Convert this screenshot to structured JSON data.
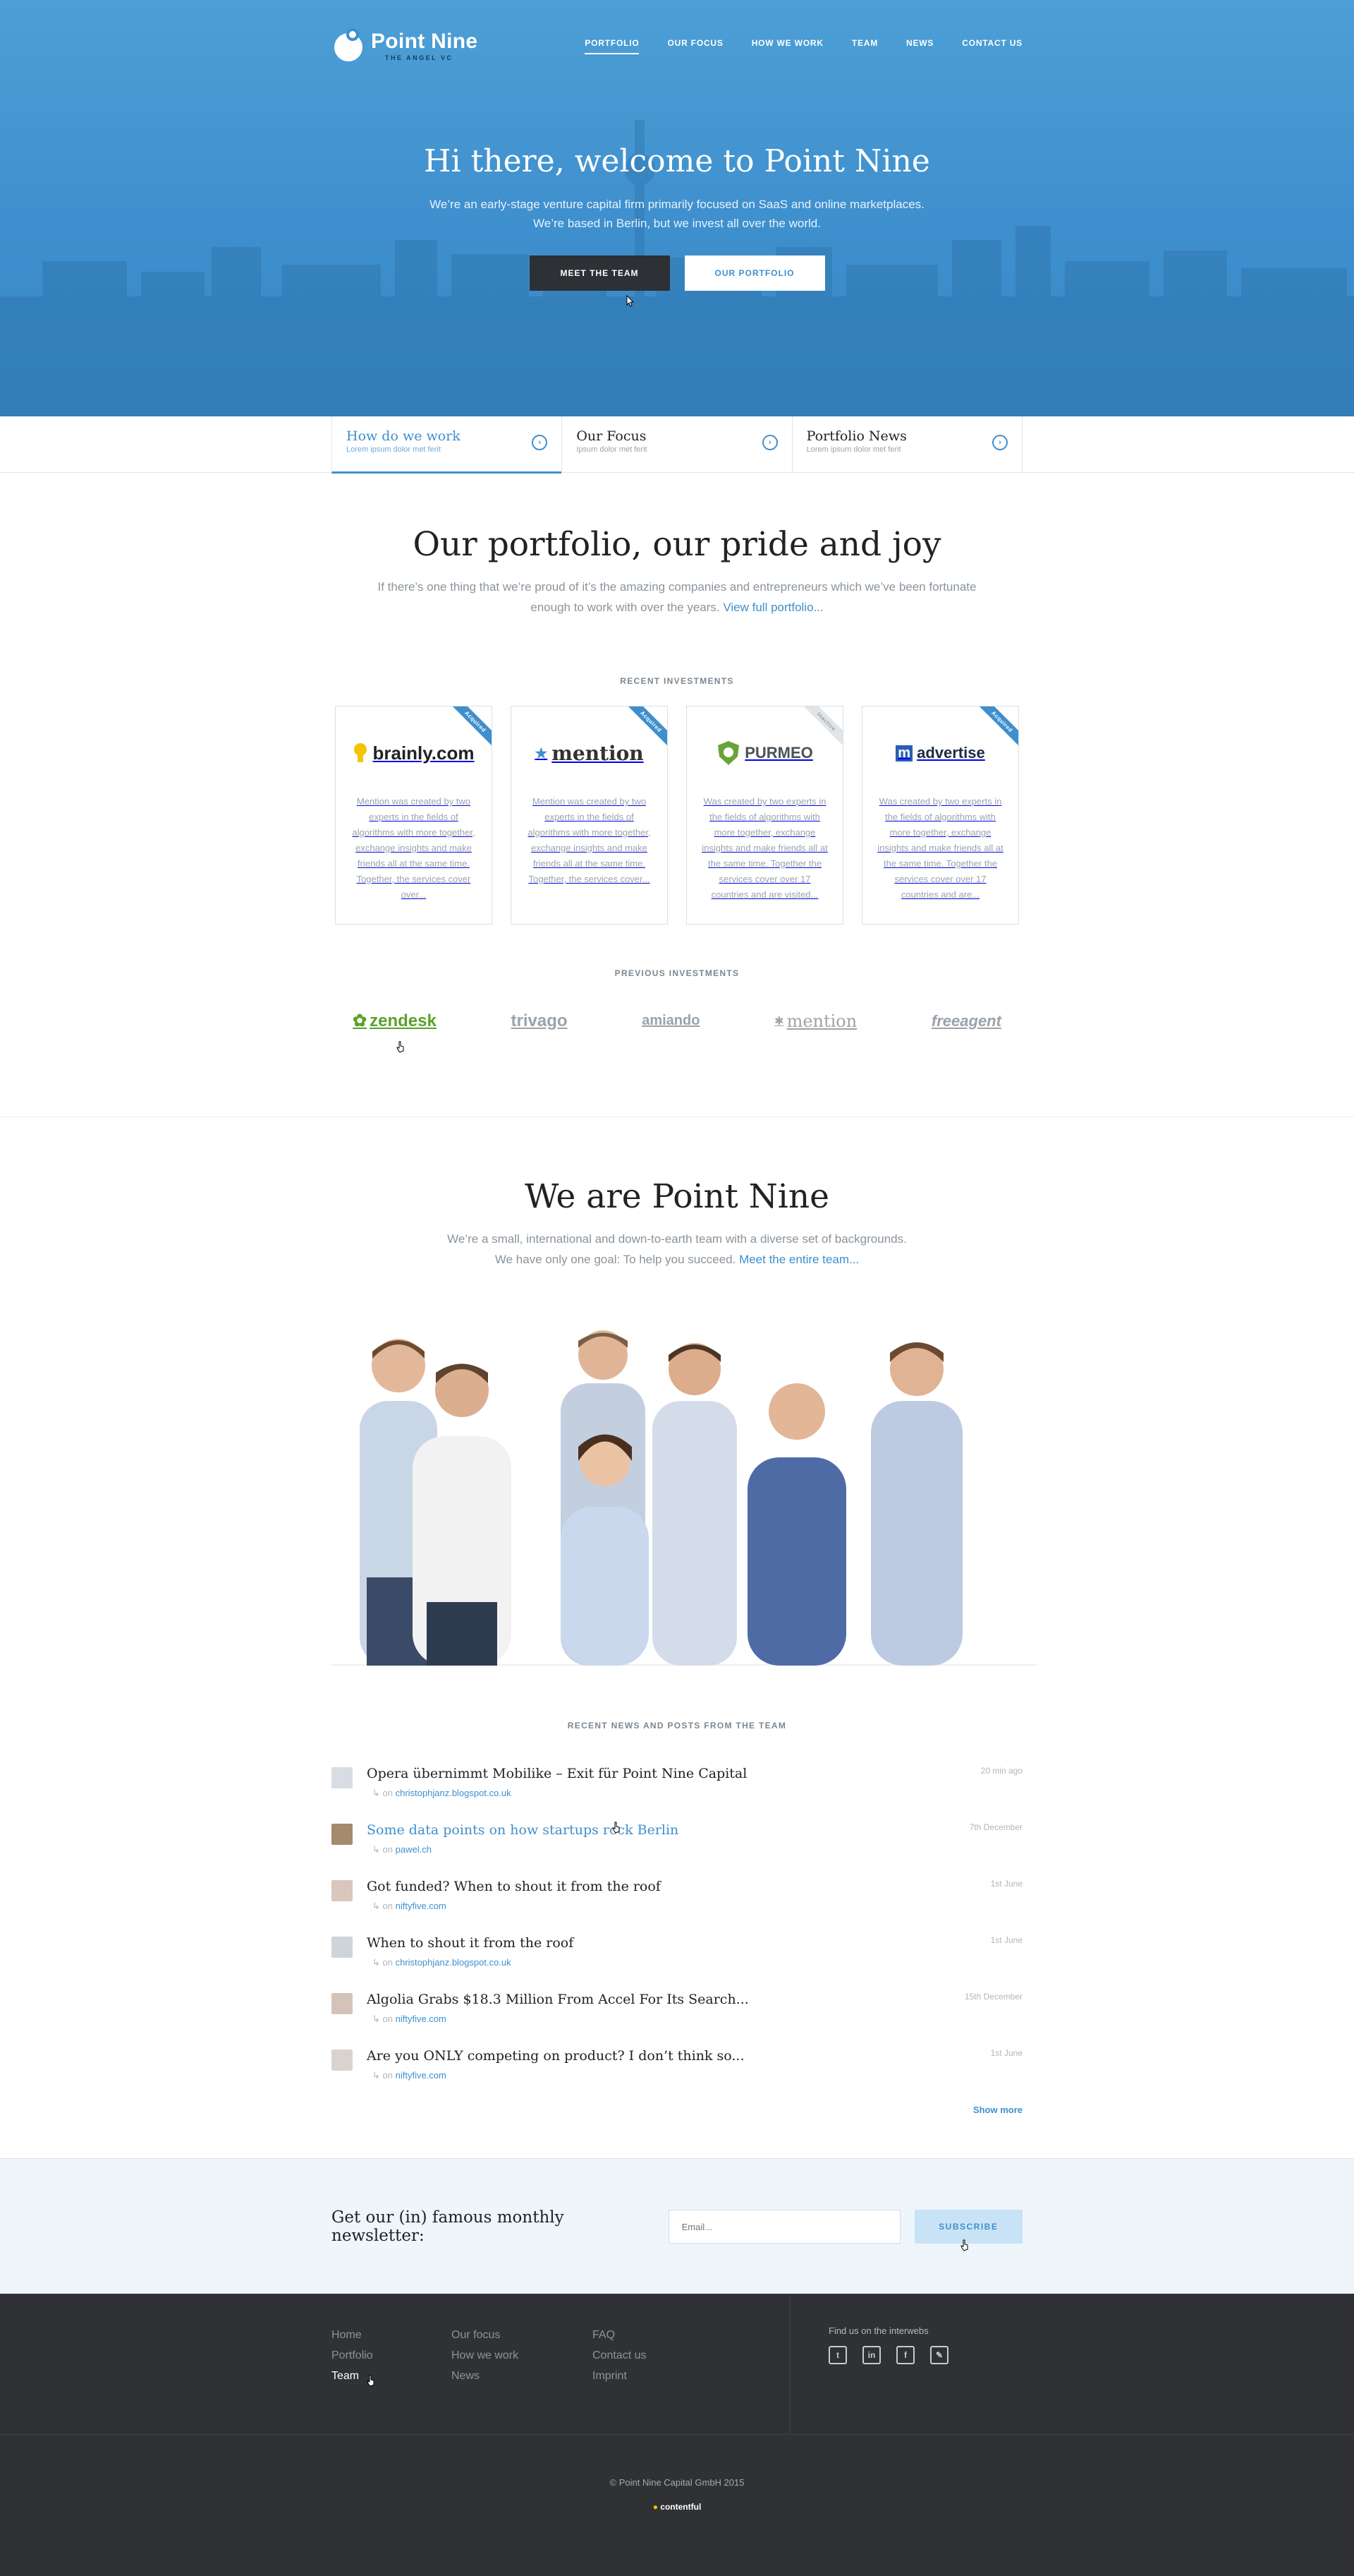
{
  "brand": {
    "name": "Point Nine",
    "tagline": "THE ANGEL VC"
  },
  "nav": [
    "PORTFOLIO",
    "OUR FOCUS",
    "HOW WE WORK",
    "TEAM",
    "NEWS",
    "CONTACT US"
  ],
  "hero": {
    "title": "Hi there, welcome to Point Nine",
    "subtitle_1": "We’re an early-stage venture capital firm primarily focused on SaaS and online marketplaces.",
    "subtitle_2": "We’re based in Berlin, but we invest all over the world.",
    "btn_team": "MEET THE TEAM",
    "btn_portfolio": "OUR PORTFOLIO"
  },
  "tabs": [
    {
      "title": "How do we work",
      "sub": "Lorem ipsum dolor met ferit"
    },
    {
      "title": "Our Focus",
      "sub": "Ipsum dolor met ferit"
    },
    {
      "title": "Portfolio News",
      "sub": "Lorem ipsum dolor met ferit"
    }
  ],
  "portfolio": {
    "title": "Our portfolio, our pride and joy",
    "lead_1": "If there’s one thing that we’re proud of it’s the amazing companies and entrepreneurs which we’ve been fortunate",
    "lead_2": "enough to work with over the years.",
    "lead_link": "View full portfolio...",
    "recent_label": "RECENT INVESTMENTS",
    "previous_label": "PREVIOUS INVESTMENTS",
    "cards": [
      {
        "name": "brainly.com",
        "ribbon": "Acquired",
        "text": "Mention was created by two experts in the fields of algorithms with more together, exchange insights and make friends all at the same time. Together, the services cover over..."
      },
      {
        "name": "mention",
        "ribbon": "Acquired",
        "text": "Mention was created by two experts in the fields of algorithms with more together, exchange insights and make friends all at the same time. Together, the services cover..."
      },
      {
        "name": "PURMEO",
        "ribbon": "Inactive",
        "text": "Was created by two experts in the fields of algorithms with more together, exchange insights and make friends all at the same time. Together the services cover over 17 countries and are visited..."
      },
      {
        "name": "advertise",
        "ribbon": "Acquired",
        "text": "Was created by two experts in the fields of algorithms with more together, exchange insights and make friends all at the same time. Together the services cover over 17 countries and are..."
      }
    ],
    "previous": [
      "zendesk",
      "trivago",
      "amiando",
      "mention",
      "freeagent"
    ]
  },
  "team": {
    "title": "We are Point Nine",
    "lead_1": "We’re a small, international and down-to-earth team with a diverse set of backgrounds.",
    "lead_2": "We have only one goal: To help you succeed.",
    "lead_link": "Meet the entire team..."
  },
  "news": {
    "label": "RECENT NEWS AND POSTS FROM THE TEAM",
    "on": "on",
    "items": [
      {
        "title": "Opera übernimmt Mobilike – Exit für Point Nine Capital",
        "source": "christophjanz.blogspot.co.uk",
        "date": "20 min ago"
      },
      {
        "title": "Some data points on how startups rock Berlin",
        "source": "pawel.ch",
        "date": "7th December"
      },
      {
        "title": "Got funded? When to shout it from the roof",
        "source": "niftyfive.com",
        "date": "1st June"
      },
      {
        "title": "When to shout it from the roof",
        "source": "christophjanz.blogspot.co.uk",
        "date": "1st June"
      },
      {
        "title": "Algolia Grabs $18.3 Million From Accel For Its Search...",
        "source": "niftyfive.com",
        "date": "15th December"
      },
      {
        "title": "Are you ONLY competing on product? I don’t think so...",
        "source": "niftyfive.com",
        "date": "1st June"
      }
    ],
    "show_more": "Show more"
  },
  "newsletter": {
    "title": "Get our (in) famous monthly newsletter:",
    "placeholder": "Email...",
    "button": "SUBSCRIBE"
  },
  "footer": {
    "col1": [
      "Home",
      "Portfolio",
      "Team"
    ],
    "col2": [
      "Our focus",
      "How we work",
      "News"
    ],
    "col3": [
      "FAQ",
      "Contact us",
      "Imprint"
    ],
    "social_title": "Find us on the interwebs",
    "copyright": "© Point Nine Capital GmbH 2015",
    "powered": "contentful"
  }
}
